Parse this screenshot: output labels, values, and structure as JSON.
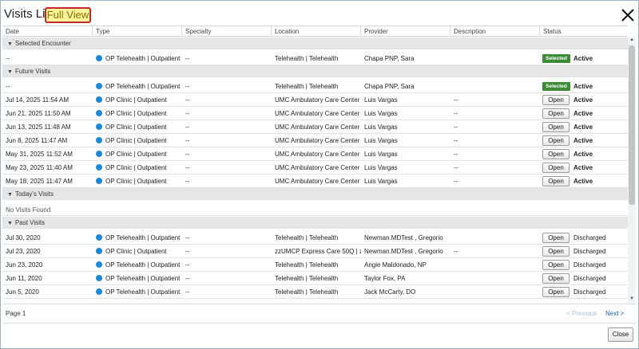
{
  "window": {
    "title": "Visits List",
    "badge": "Full View"
  },
  "columns": [
    "Date",
    "Type",
    "Specialty",
    "Location",
    "Provider",
    "Description",
    "Status"
  ],
  "groups": {
    "selected": "Selected Encounter",
    "future": "Future Visits",
    "today": "Today's Visits",
    "past": "Past Visits"
  },
  "today_empty": "No Visits Found",
  "rows": {
    "selected": [
      {
        "date": "--",
        "type": "OP Telehealth | Outpatient",
        "specialty": "--",
        "location": "Telehealth | Telehealth",
        "provider": "Chapa PNP, Sara",
        "description": "",
        "badge": "Selected",
        "status": "Active"
      }
    ],
    "future": [
      {
        "date": "--",
        "type": "OP Telehealth | Outpatient",
        "specialty": "--",
        "location": "Telehealth | Telehealth",
        "provider": "Chapa PNP, Sara",
        "description": "",
        "badge": "Selected",
        "status": "Active"
      },
      {
        "date": "Jul 14, 2025 11:54 AM",
        "type": "OP Clinic | Outpatient",
        "specialty": "--",
        "location": "UMC Ambulatory Care Center ...",
        "provider": "Luis Vargas",
        "description": "--",
        "button": "Open",
        "status": "Active"
      },
      {
        "date": "Jun 21, 2025 11:50 AM",
        "type": "OP Clinic | Outpatient",
        "specialty": "--",
        "location": "UMC Ambulatory Care Center ...",
        "provider": "Luis Vargas",
        "description": "--",
        "button": "Open",
        "status": "Active"
      },
      {
        "date": "Jun 13, 2025 11:48 AM",
        "type": "OP Clinic | Outpatient",
        "specialty": "--",
        "location": "UMC Ambulatory Care Center ...",
        "provider": "Luis Vargas",
        "description": "--",
        "button": "Open",
        "status": "Active"
      },
      {
        "date": "Jun 8, 2025 11:47 AM",
        "type": "OP Clinic | Outpatient",
        "specialty": "--",
        "location": "UMC Ambulatory Care Center ...",
        "provider": "Luis Vargas",
        "description": "--",
        "button": "Open",
        "status": "Active"
      },
      {
        "date": "May 31, 2025 11:52 AM",
        "type": "OP Clinic | Outpatient",
        "specialty": "--",
        "location": "UMC Ambulatory Care Center ...",
        "provider": "Luis Vargas",
        "description": "--",
        "button": "Open",
        "status": "Active"
      },
      {
        "date": "May 23, 2025 11:40 AM",
        "type": "OP Clinic | Outpatient",
        "specialty": "--",
        "location": "UMC Ambulatory Care Center ...",
        "provider": "Luis Vargas",
        "description": "--",
        "button": "Open",
        "status": "Active"
      },
      {
        "date": "May 18, 2025 11:47 AM",
        "type": "OP Clinic | Outpatient",
        "specialty": "--",
        "location": "UMC Ambulatory Care Center ...",
        "provider": "Luis Vargas",
        "description": "--",
        "button": "Open",
        "status": "Active"
      }
    ],
    "past": [
      {
        "date": "Jul 30, 2020",
        "type": "OP Telehealth | Outpatient",
        "specialty": "--",
        "location": "Telehealth | Telehealth",
        "provider": "Newman.MDTest , Gregorio",
        "description": "",
        "button": "Open",
        "status": "Discharged"
      },
      {
        "date": "Jul 23, 2020",
        "type": "OP Clinic | Outpatient",
        "specialty": "--",
        "location": "zzUMCP Express Care 50Q | z...",
        "provider": "Newman.MDTest , Gregorio",
        "description": "--",
        "button": "Open",
        "status": "Discharged"
      },
      {
        "date": "Jun 23, 2020",
        "type": "OP Telehealth | Outpatient",
        "specialty": "--",
        "location": "Telehealth | Telehealth",
        "provider": "Angie Maldonado, NP",
        "description": "",
        "button": "Open",
        "status": "Discharged"
      },
      {
        "date": "Jun 11, 2020",
        "type": "OP Telehealth | Outpatient",
        "specialty": "--",
        "location": "Telehealth | Telehealth",
        "provider": "Taylor Fox, PA",
        "description": "",
        "button": "Open",
        "status": "Discharged"
      },
      {
        "date": "Jun 5, 2020",
        "type": "OP Telehealth | Outpatient",
        "specialty": "--",
        "location": "Telehealth | Telehealth",
        "provider": "Jack McCarty, DO",
        "description": "",
        "button": "Open",
        "status": "Discharged"
      }
    ]
  },
  "pager": {
    "page": "Page 1",
    "previous": "< Previous",
    "next": "Next >"
  },
  "footer": {
    "close": "Close"
  },
  "colors": {
    "selected_badge": "#3d8b37",
    "dot": "#1e88d6",
    "group_bg": "#e6e6e6",
    "link": "#1d5fa8"
  }
}
